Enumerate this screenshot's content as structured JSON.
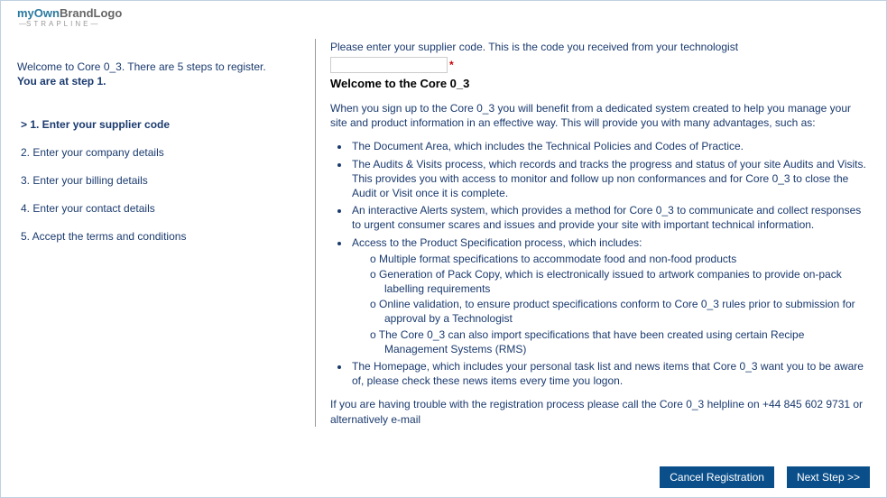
{
  "logo": {
    "part1": "my",
    "part2": "Own",
    "part3": "BrandLogo",
    "strapline": "STRAPLINE"
  },
  "left": {
    "welcome": "Welcome to Core 0_3. There are 5 steps to register.",
    "at_step": "You are at step 1.",
    "steps": [
      "> 1. Enter your supplier code",
      "2. Enter your company details",
      "3. Enter your billing details",
      "4. Enter your contact details",
      "5. Accept the terms and conditions"
    ]
  },
  "right": {
    "prompt": "Please enter your supplier code. This is the code you received from your technologist",
    "code_value": "",
    "asterisk": "*",
    "title": "Welcome to the Core 0_3",
    "intro": "When you sign up to the Core 0_3 you will benefit from a dedicated system created to help you manage your site and product information in an effective way. This will provide you with many advantages, such as:",
    "bullets": {
      "b1": "The Document Area, which includes the Technical Policies and Codes of Practice.",
      "b2": "The Audits & Visits process, which records and tracks the progress and status of your site Audits and Visits. This provides you with access to monitor and follow up non conformances and for Core 0_3 to close the Audit or Visit once it is complete.",
      "b3": "An interactive Alerts system, which provides a method for Core 0_3 to communicate and collect responses to urgent consumer scares and issues and provide your site with important technical information.",
      "b4": "Access to the Product Specification process, which includes:",
      "b4_sub": {
        "s1": "Multiple format specifications to accommodate food and non-food products",
        "s2": "Generation of Pack Copy, which is electronically issued to artwork companies to provide on-pack labelling requirements",
        "s3": "Online validation, to ensure product specifications conform to Core 0_3 rules prior to submission for approval by a Technologist",
        "s4": "The Core 0_3 can also import specifications that have been created using certain Recipe Management Systems (RMS)"
      },
      "b5": "The Homepage, which includes your personal task list and news items that Core 0_3 want you to be aware of, please check these news items every time you logon."
    },
    "footnote": "If you are having trouble with the registration process please call the Core 0_3 helpline on +44 845 602 9731 or alternatively e-mail"
  },
  "buttons": {
    "cancel": "Cancel Registration",
    "next": "Next Step >>"
  }
}
